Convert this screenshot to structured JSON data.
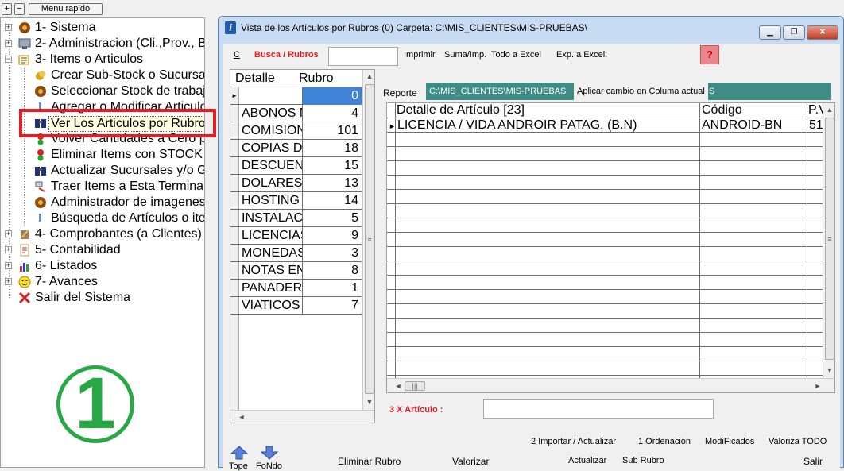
{
  "left_toolbar": {
    "plus": "+",
    "minus": "−",
    "menu_rapido": "Menu rapido"
  },
  "tree": {
    "items": [
      {
        "label": "1- Sistema",
        "icon": "gear-icon",
        "expander": "+"
      },
      {
        "label": "2- Administracion (Cli.,Prov., B",
        "icon": "monitor-icon",
        "expander": "+"
      },
      {
        "label": "3- Items o Articulos",
        "icon": "folder-icon",
        "expander": "−"
      },
      {
        "label": "Crear Sub-Stock o Sucursa",
        "icon": "coins-icon"
      },
      {
        "label": "Seleccionar Stock de trabaj",
        "icon": "gear-icon"
      },
      {
        "label": "Agregar o Modificar Articulo",
        "icon": "pin-icon"
      },
      {
        "label": "Ver Los Articulos por Rubros",
        "icon": "binoculars-icon"
      },
      {
        "label": "Volver Cantidades a Cero p",
        "icon": "traffic-light-icon"
      },
      {
        "label": "Eliminar Items con STOCK",
        "icon": "traffic-light-icon"
      },
      {
        "label": "Actualizar Sucursales y/o  G",
        "icon": "binoculars-icon"
      },
      {
        "label": "Traer Items a Esta Terminal",
        "icon": "transfer-icon"
      },
      {
        "label": "Administrador de imagenes",
        "icon": "gear-icon"
      },
      {
        "label": "Búsqueda de Artículos o ite",
        "icon": "pin-icon"
      },
      {
        "label": "4- Comprobantes (a Clientes)",
        "icon": "pencil-icon",
        "expander": "+"
      },
      {
        "label": "5- Contabilidad",
        "icon": "notebook-icon",
        "expander": "+"
      },
      {
        "label": "6- Listados",
        "icon": "chart-icon",
        "expander": "+"
      },
      {
        "label": "7- Avances",
        "icon": "smiley-icon",
        "expander": "+"
      },
      {
        "label": "Salir del Sistema",
        "icon": "red-x-icon"
      }
    ],
    "annotation_number": "1"
  },
  "window": {
    "title": "Vista de los Artículos por Rubros (0) Carpeta: C:\\MIS_CLIENTES\\MIS-PRUEBAS\\",
    "caption_buttons": {
      "minimize": "▁",
      "restore": "❐",
      "close": "✕"
    },
    "toolbar": {
      "c": "C",
      "busca": "Busca / Rubros",
      "imprimir": "Imprimir",
      "suma": "Suma/Imp.",
      "todo_excel": "Todo a Excel",
      "exp_excel": "Exp. a Excel:",
      "help": "?"
    },
    "rubros_grid": {
      "headers": {
        "detalle": "Detalle",
        "rubro": "Rubro"
      },
      "rows": [
        {
          "detalle": "",
          "rubro": "0"
        },
        {
          "detalle": "ABONOS M",
          "rubro": "4"
        },
        {
          "detalle": "COMISION",
          "rubro": "101"
        },
        {
          "detalle": "COPIAS D",
          "rubro": "18"
        },
        {
          "detalle": "DESCUEN",
          "rubro": "15"
        },
        {
          "detalle": "DOLARES",
          "rubro": "13"
        },
        {
          "detalle": "HOSTING W",
          "rubro": "14"
        },
        {
          "detalle": "INSTALAC",
          "rubro": "5"
        },
        {
          "detalle": "LICENCIAS",
          "rubro": "9"
        },
        {
          "detalle": "MONEDAS",
          "rubro": "3"
        },
        {
          "detalle": "NOTAS EN",
          "rubro": "8"
        },
        {
          "detalle": "PANADER",
          "rubro": "1"
        },
        {
          "detalle": "VIATICOS",
          "rubro": "7"
        }
      ]
    },
    "reporte": {
      "label": "Reporte",
      "path": "C:\\MIS_CLIENTES\\MIS-PRUEBAS",
      "apply_button": "Aplicar cambio en Columa actual",
      "tail": "S"
    },
    "articles_grid": {
      "headers": {
        "detalle": "Detalle de Artículo [23]",
        "codigo": "Código",
        "pv": "P.V"
      },
      "rows": [
        {
          "detalle": "LICENCIA / VIDA ANDROIR PATAG. (B.N)",
          "codigo": "ANDROID-BN",
          "pv": "51"
        }
      ]
    },
    "x_articulo": {
      "label": "3 X Artículo :"
    },
    "bottom_links": {
      "importar": "2 Importar / Actualizar",
      "ordenacion": "1 Ordenacion",
      "modificados": "ModiFicados",
      "valoriza_todo": "Valoriza TODO"
    },
    "bottom_buttons": {
      "tope": "Tope",
      "fondo": "FoNdo",
      "eliminar": "Eliminar Rubro",
      "valorizar": "Valorizar",
      "actualizar": "Actualizar",
      "sub_rubro": "Sub Rubro",
      "salir": "Salir"
    }
  }
}
